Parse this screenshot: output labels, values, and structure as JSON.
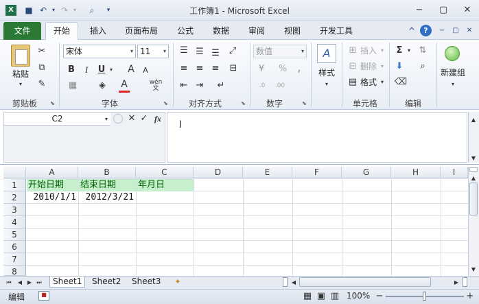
{
  "window": {
    "title": "工作簿1 - Microsoft Excel"
  },
  "quick_access": {
    "icons": [
      "excel-logo-icon",
      "save-icon",
      "undo-icon",
      "redo-icon",
      "print-preview-icon",
      "customize-icon"
    ]
  },
  "tabs": {
    "file": "文件",
    "home": "开始",
    "insert": "插入",
    "layout": "页面布局",
    "formulas": "公式",
    "data": "数据",
    "review": "审阅",
    "view": "视图",
    "developer": "开发工具"
  },
  "ribbon": {
    "clipboard": {
      "paste": "粘贴",
      "group": "剪贴板"
    },
    "font": {
      "name": "宋体",
      "size": "11",
      "bold": "B",
      "italic": "I",
      "underline": "U",
      "group": "字体",
      "grow": "A",
      "shrink": "A",
      "color_a": "A",
      "wen": "wén"
    },
    "alignment": {
      "group": "对齐方式"
    },
    "number": {
      "format": "数值",
      "percent": "%",
      "comma": ",",
      "group": "数字"
    },
    "styles": {
      "label": "样式"
    },
    "cells": {
      "insert": "插入",
      "delete": "删除",
      "format": "格式",
      "group": "单元格"
    },
    "editing": {
      "sum": "Σ",
      "group": "编辑"
    },
    "newgroup": {
      "label": "新建组"
    }
  },
  "formula_bar": {
    "name_box": "C2",
    "fx": "fx",
    "cancel": "✕",
    "enter": "✓",
    "value": ""
  },
  "grid": {
    "columns": [
      "A",
      "B",
      "C",
      "D",
      "E",
      "F",
      "G",
      "H",
      "I"
    ],
    "rows": [
      "1",
      "2",
      "3",
      "4",
      "5",
      "6",
      "7",
      "8"
    ],
    "a1": "开始日期",
    "b1": "结束日期",
    "c1": "年月日",
    "a2": "2010/1/1",
    "b2": "2012/3/21"
  },
  "sheets": {
    "tabs": [
      "Sheet1",
      "Sheet2",
      "Sheet3"
    ]
  },
  "status": {
    "mode": "编辑",
    "zoom": "100%",
    "minus": "−",
    "plus": "+"
  },
  "colors": {
    "green_fill": "#c6efce",
    "green_text": "#006100",
    "file_tab": "#2a7a36"
  }
}
